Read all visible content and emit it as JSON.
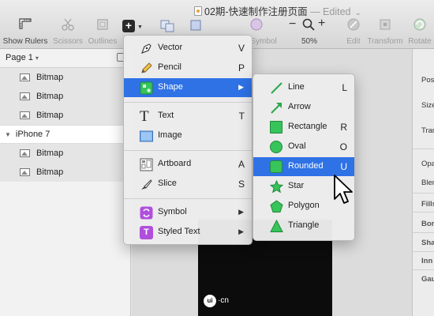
{
  "window": {
    "title": "02期-快速制作注册页面",
    "edited": "— Edited",
    "title_chevron": "⌄"
  },
  "toolbar": {
    "show_rulers": "Show Rulers",
    "scissors": "Scissors",
    "outlines": "Outlines",
    "insert": "+",
    "symbol": "Symbol",
    "zoom_minus": "−",
    "zoom_plus": "+",
    "zoom_level": "50%",
    "edit": "Edit",
    "transform": "Transform",
    "rotate": "Rotate"
  },
  "layers": {
    "page_label": "Page 1",
    "items": [
      {
        "type": "bitmap",
        "label": "Bitmap"
      },
      {
        "type": "bitmap",
        "label": "Bitmap"
      },
      {
        "type": "bitmap",
        "label": "Bitmap"
      },
      {
        "type": "group",
        "label": "iPhone 7"
      },
      {
        "type": "bitmap",
        "label": "Bitmap"
      },
      {
        "type": "bitmap",
        "label": "Bitmap"
      }
    ]
  },
  "insert_menu": {
    "items": [
      {
        "label": "Vector",
        "key": "V",
        "icon": "vector-pen-icon"
      },
      {
        "label": "Pencil",
        "key": "P",
        "icon": "pencil-icon"
      },
      {
        "label": "Shape",
        "key": "▶",
        "icon": "shape-icon",
        "active": true
      },
      {
        "label": "Text",
        "key": "T",
        "icon": "text-icon"
      },
      {
        "label": "Image",
        "key": "",
        "icon": "image-icon"
      },
      {
        "label": "Artboard",
        "key": "A",
        "icon": "artboard-icon"
      },
      {
        "label": "Slice",
        "key": "S",
        "icon": "slice-knife-icon"
      },
      {
        "label": "Symbol",
        "key": "▶",
        "icon": "symbol-icon"
      },
      {
        "label": "Styled Text",
        "key": "▶",
        "icon": "styled-text-icon"
      }
    ]
  },
  "shape_menu": {
    "items": [
      {
        "label": "Line",
        "key": "L"
      },
      {
        "label": "Arrow",
        "key": ""
      },
      {
        "label": "Rectangle",
        "key": "R"
      },
      {
        "label": "Oval",
        "key": "O"
      },
      {
        "label": "Rounded",
        "key": "U",
        "active": true
      },
      {
        "label": "Star",
        "key": ""
      },
      {
        "label": "Polygon",
        "key": ""
      },
      {
        "label": "Triangle",
        "key": ""
      }
    ]
  },
  "inspector": {
    "rows": [
      "Pos",
      "Size",
      "Tran",
      "Opa",
      "Blen",
      "Fills",
      "Bor",
      "Sha",
      "Inn",
      "Gau"
    ]
  },
  "watermark": {
    "badge": "ui",
    "text": "·cn"
  },
  "colors": {
    "accent": "#2f72e6",
    "shape_green": "#37c45a",
    "symbol_purple": "#b04fdc"
  }
}
